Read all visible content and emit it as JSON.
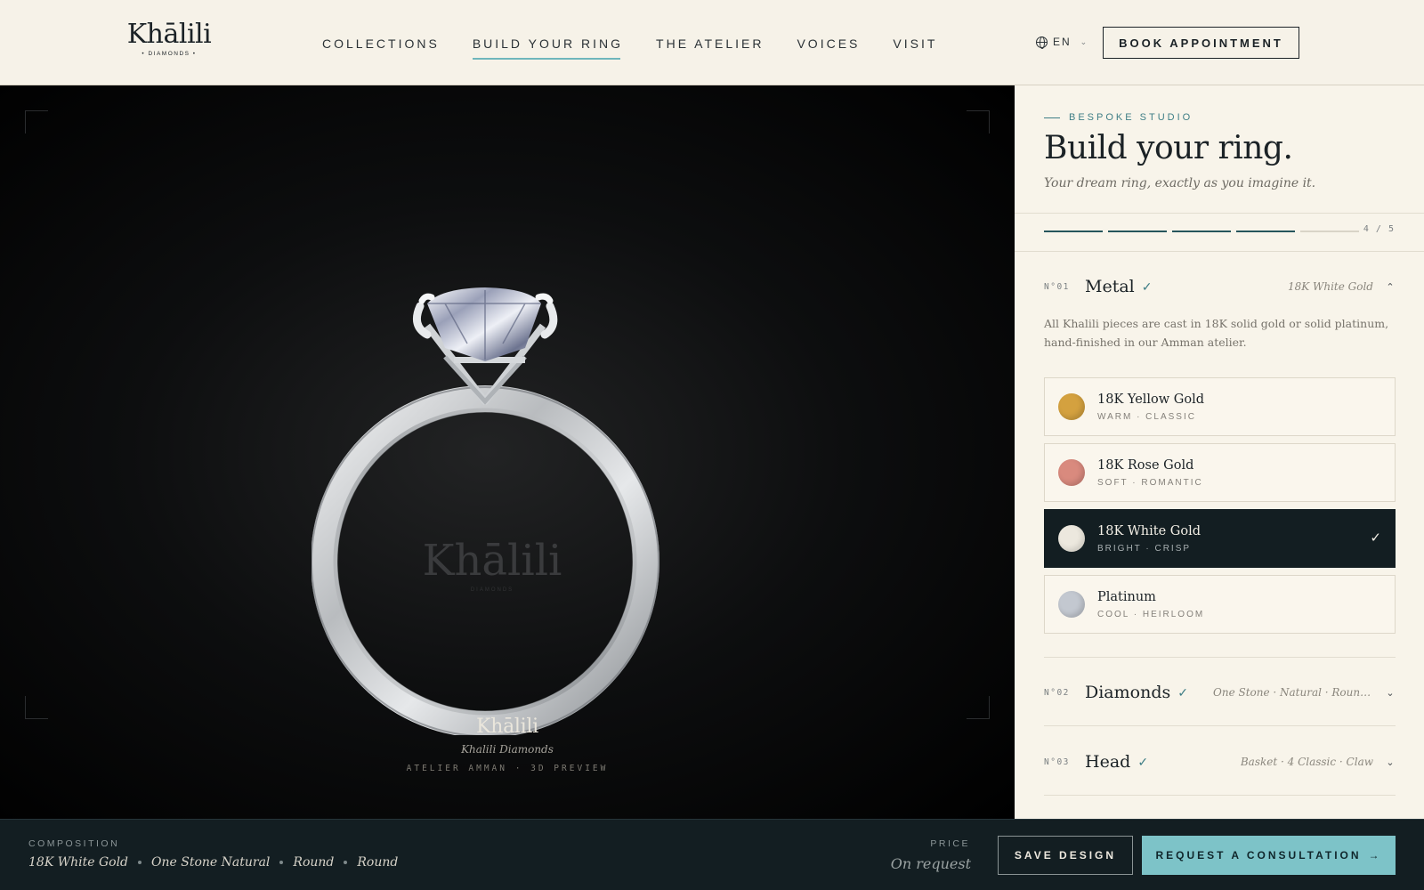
{
  "brand": {
    "logo_text": "Khālili",
    "logo_sub": "• DIAMONDS •"
  },
  "nav": {
    "items": [
      {
        "label": "COLLECTIONS"
      },
      {
        "label": "BUILD YOUR RING"
      },
      {
        "label": "THE ATELIER"
      },
      {
        "label": "VOICES"
      },
      {
        "label": "VISIT"
      }
    ],
    "active_index": 1
  },
  "header": {
    "language": "EN",
    "book_label": "BOOK APPOINTMENT"
  },
  "viewer": {
    "watermark": "Khālili",
    "watermark_sub": "DIAMONDS",
    "caption_logo": "Khālili",
    "caption_name": "Khalili Diamonds",
    "caption_tag": "ATELIER AMMAN · 3D PREVIEW"
  },
  "panel": {
    "eyebrow": "BESPOKE STUDIO",
    "title": "Build your ring.",
    "subtitle": "Your dream ring, exactly as you imagine it.",
    "progress": {
      "completed": 4,
      "total": 5,
      "label": "4 / 5"
    },
    "sections": [
      {
        "num": "N°01",
        "title": "Metal",
        "check": "✓",
        "value": "18K White Gold",
        "chevron": "⌃"
      },
      {
        "num": "N°02",
        "title": "Diamonds",
        "check": "✓",
        "value": "One Stone · Natural · Round · ...",
        "chevron": "⌄"
      },
      {
        "num": "N°03",
        "title": "Head",
        "check": "✓",
        "value": "Basket · 4 Classic · Claw",
        "chevron": "⌄"
      }
    ],
    "metal_desc": "All Khalili pieces are cast in 18K solid gold or solid platinum, hand-finished in our Amman atelier.",
    "metal_options": [
      {
        "name": "18K Yellow Gold",
        "tags": "WARM · CLASSIC",
        "color": "#d4a13f",
        "selected": false
      },
      {
        "name": "18K Rose Gold",
        "tags": "SOFT · ROMANTIC",
        "color": "#d98a7e",
        "selected": false
      },
      {
        "name": "18K White Gold",
        "tags": "BRIGHT · CRISP",
        "color": "#ece8de",
        "selected": true
      },
      {
        "name": "Platinum",
        "tags": "COOL · HEIRLOOM",
        "color": "#c3c8d0",
        "selected": false
      }
    ],
    "selected_check": "✓"
  },
  "bottom": {
    "composition_label": "COMPOSITION",
    "composition": [
      "18K White Gold",
      "One Stone Natural",
      "Round",
      "Round"
    ],
    "price_label": "PRICE",
    "price_value": "On request",
    "save_label": "SAVE DESIGN",
    "consult_label": "REQUEST A CONSULTATION",
    "consult_arrow": "→"
  },
  "colors": {
    "accent": "#7dc3c8",
    "dark": "#131e22",
    "cream": "#f6f2e8",
    "teal": "#3f7e86"
  }
}
